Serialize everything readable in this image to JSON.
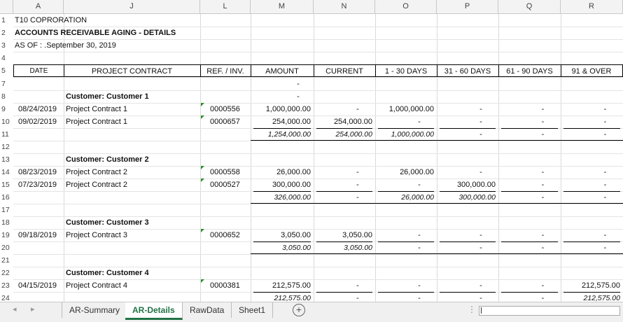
{
  "columns": [
    "A",
    "J",
    "L",
    "M",
    "N",
    "O",
    "P",
    "Q",
    "R"
  ],
  "row_numbers": [
    "1",
    "2",
    "3",
    "4",
    "5",
    "7",
    "8",
    "9",
    "10",
    "11",
    "12",
    "13",
    "14",
    "15",
    "16",
    "17",
    "18",
    "19",
    "20",
    "21",
    "22",
    "23",
    "24"
  ],
  "title": {
    "company": "T10 COPRORATION",
    "report": "ACCOUNTS RECEIVABLE AGING - DETAILS",
    "asof": "AS OF : .September 30, 2019"
  },
  "headers": {
    "date": "DATE",
    "project": "PROJECT CONTRACT",
    "ref": "REF. / INV.",
    "amount": "AMOUNT",
    "current": "CURRENT",
    "d1_30": "1 - 30 DAYS",
    "d31_60": "31 - 60 DAYS",
    "d61_90": "61 - 90 DAYS",
    "d91": "91 & OVER"
  },
  "row7": {
    "amount": "-"
  },
  "row8": {
    "amount": "-"
  },
  "customers": [
    {
      "label": "Customer:  Customer 1",
      "rows": [
        {
          "date": "08/24/2019",
          "project": "Project Contract 1",
          "ref": "0000556",
          "amount": "1,000,000.00",
          "current": "-",
          "d1_30": "1,000,000.00",
          "d31_60": "-",
          "d61_90": "-",
          "d91": "-"
        },
        {
          "date": "09/02/2019",
          "project": "Project Contract 1",
          "ref": "0000657",
          "amount": "254,000.00",
          "current": "254,000.00",
          "d1_30": "-",
          "d31_60": "-",
          "d61_90": "-",
          "d91": "-"
        }
      ],
      "total": {
        "amount": "1,254,000.00",
        "current": "254,000.00",
        "d1_30": "1,000,000.00",
        "d31_60": "-",
        "d61_90": "-",
        "d91": "-"
      }
    },
    {
      "label": "Customer:  Customer 2",
      "rows": [
        {
          "date": "08/23/2019",
          "project": "Project Contract 2",
          "ref": "0000558",
          "amount": "26,000.00",
          "current": "-",
          "d1_30": "26,000.00",
          "d31_60": "-",
          "d61_90": "-",
          "d91": "-"
        },
        {
          "date": "07/23/2019",
          "project": "Project Contract 2",
          "ref": "0000527",
          "amount": "300,000.00",
          "current": "-",
          "d1_30": "-",
          "d31_60": "300,000.00",
          "d61_90": "-",
          "d91": "-"
        }
      ],
      "total": {
        "amount": "326,000.00",
        "current": "-",
        "d1_30": "26,000.00",
        "d31_60": "300,000.00",
        "d61_90": "-",
        "d91": "-"
      }
    },
    {
      "label": "Customer:  Customer 3",
      "rows": [
        {
          "date": "09/18/2019",
          "project": "Project Contract 3",
          "ref": "0000652",
          "amount": "3,050.00",
          "current": "3,050.00",
          "d1_30": "-",
          "d31_60": "-",
          "d61_90": "-",
          "d91": "-"
        }
      ],
      "total": {
        "amount": "3,050.00",
        "current": "3,050.00",
        "d1_30": "-",
        "d31_60": "-",
        "d61_90": "-",
        "d91": "-"
      }
    },
    {
      "label": "Customer:  Customer 4",
      "rows": [
        {
          "date": "04/15/2019",
          "project": "Project Contract 4",
          "ref": "0000381",
          "amount": "212,575.00",
          "current": "-",
          "d1_30": "-",
          "d31_60": "-",
          "d61_90": "-",
          "d91": "212,575.00"
        }
      ],
      "total": {
        "amount": "212,575.00",
        "current": "-",
        "d1_30": "-",
        "d31_60": "-",
        "d61_90": "-",
        "d91": "212,575.00"
      }
    }
  ],
  "tabs": [
    "AR-Summary",
    "AR-Details",
    "RawData",
    "Sheet1"
  ],
  "active_tab": "AR-Details",
  "colors": {
    "accent": "#217346",
    "error_triangle": "#2e8b2e"
  }
}
